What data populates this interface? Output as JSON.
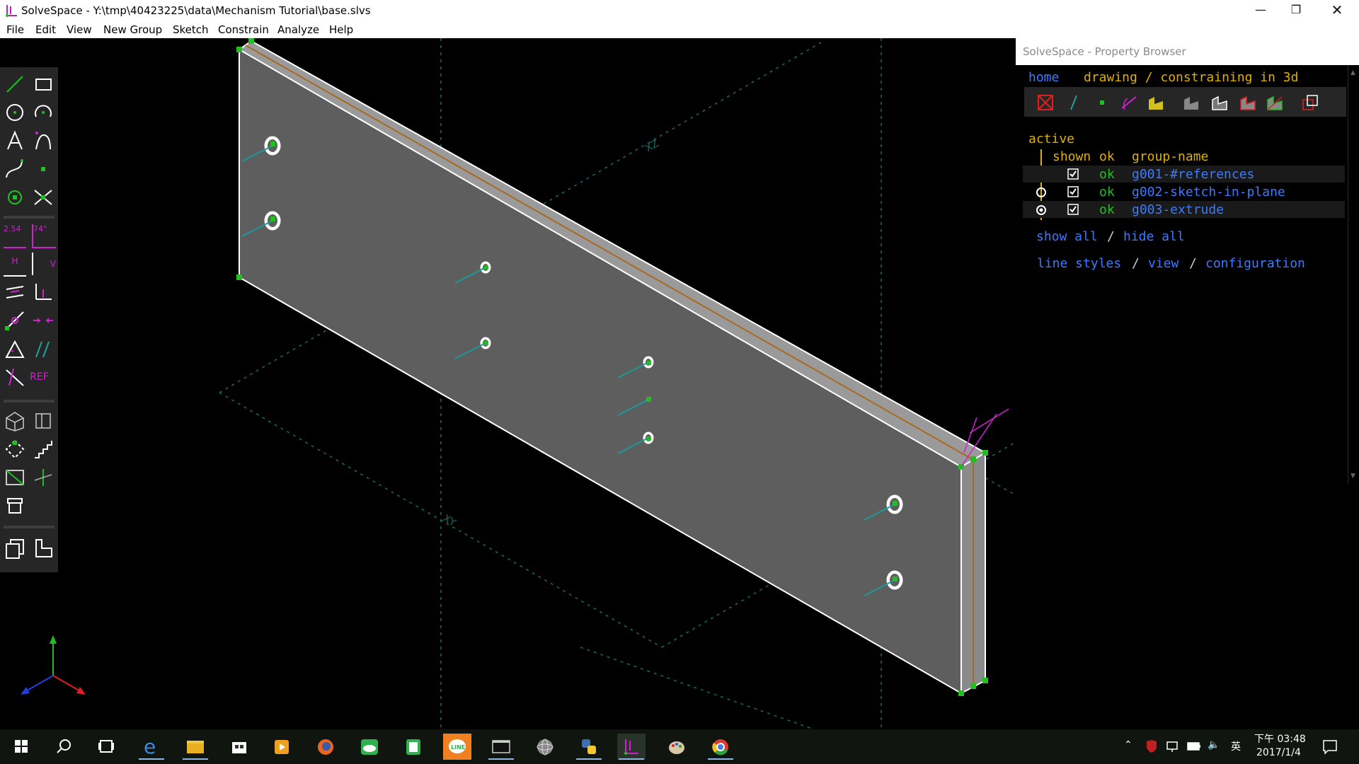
{
  "window": {
    "title": "SolveSpace - Y:\\tmp\\40423225\\data\\Mechanism Tutorial\\base.slvs",
    "controls": [
      "minimize",
      "restore",
      "close"
    ]
  },
  "menu": [
    "File",
    "Edit",
    "View",
    "New Group",
    "Sketch",
    "Constrain",
    "Analyze",
    "Help"
  ],
  "canvas": {
    "labels": {
      "yz": "XZ",
      "xy": "XY"
    }
  },
  "toolbar": {
    "groups": [
      [
        "line-segment",
        "rectangle",
        "circle",
        "arc",
        "text",
        "tangent-arc",
        "bezier-spline",
        "point",
        "construction-point",
        "split-curves"
      ],
      [
        "distance-dimension",
        "angle-dimension",
        "horizontal",
        "vertical",
        "parallel",
        "perpendicular",
        "point-on-line",
        "symmetric",
        "equal",
        "lock-point",
        "other-angle",
        "reference"
      ],
      [
        "nearest-iso-view",
        "nearest-ortho-view",
        "toggle-construction",
        "step-dimension",
        "workplane",
        "extrude",
        "lathe"
      ],
      [
        "group-step-and-repeat",
        "group-linked"
      ]
    ],
    "text_labels": {
      "dim": "2.54",
      "angle": "74°",
      "h": "H",
      "v": "V",
      "ref": "REF"
    }
  },
  "property_browser": {
    "title": "SolveSpace - Property Browser",
    "nav": {
      "home": "home",
      "sep": " ",
      "context": "drawing / constraining in 3d"
    },
    "icons": [
      "show-workplanes",
      "show-normals",
      "show-points",
      "show-constraints",
      "show-faces",
      "show-shaded",
      "show-edges",
      "show-mesh",
      "show-outline",
      "show-hidden",
      "show-perspective"
    ],
    "active_label": "active",
    "headers": {
      "shown": "shown",
      "ok": "ok",
      "group": "group-name"
    },
    "groups": [
      {
        "name": "g001-#references",
        "ok": "ok",
        "shown": true,
        "active": false,
        "radio": false
      },
      {
        "name": "g002-sketch-in-plane",
        "ok": "ok",
        "shown": true,
        "active": false,
        "radio": true
      },
      {
        "name": "g003-extrude",
        "ok": "ok",
        "shown": true,
        "active": true,
        "radio": true
      }
    ],
    "actions": {
      "show_all": "show all",
      "slash": " / ",
      "hide_all": "hide all"
    },
    "footer": {
      "line_styles": "line styles",
      "view": "view",
      "configuration": "configuration",
      "slash": " / "
    }
  },
  "taskbar": {
    "apps": [
      "start",
      "search",
      "task-view",
      "edge",
      "file-explorer",
      "store",
      "media-player",
      "firefox",
      "cloud-app",
      "notepad-app",
      "line-app",
      "terminal",
      "sphere-app",
      "python",
      "solvespace",
      "paint",
      "chrome"
    ],
    "tray": {
      "time": "下午 03:48",
      "date": "2017/1/4",
      "ime": "英"
    }
  },
  "colors": {
    "accent_green": "#20c020",
    "link_blue": "#3b7bff",
    "orange": "#e0b000",
    "magenta": "#d020d0",
    "face": "#5e5e5e"
  }
}
